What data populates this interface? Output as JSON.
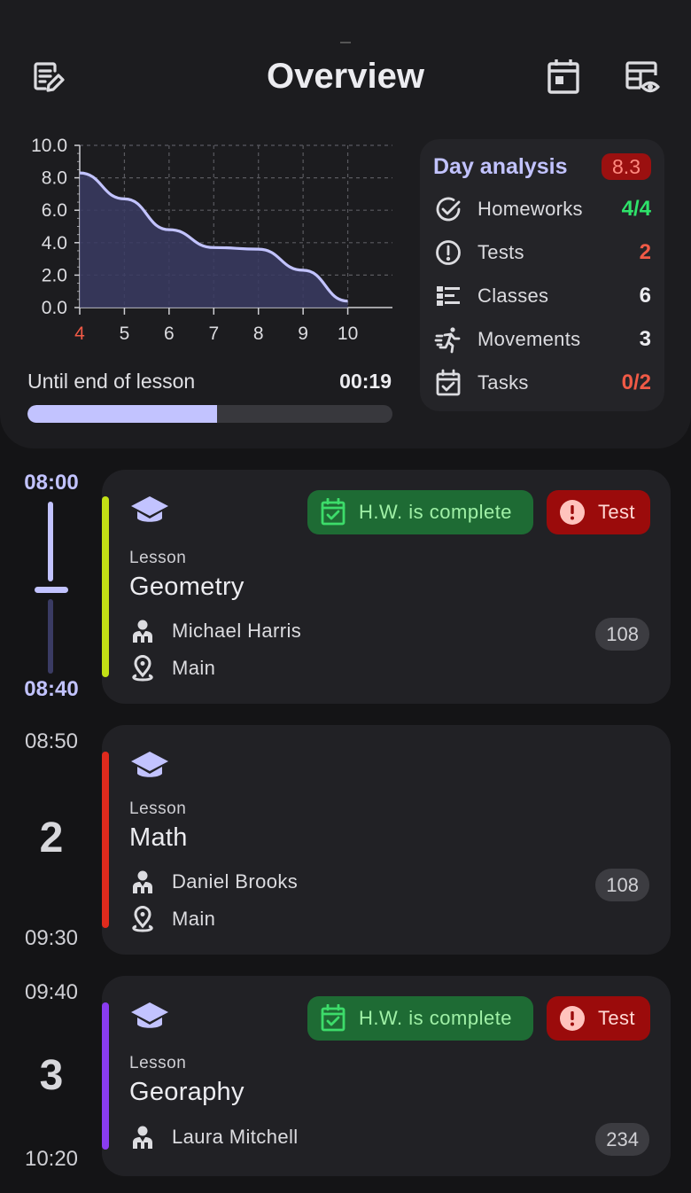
{
  "header": {
    "title": "Overview",
    "left_icon": "edit-notes-icon",
    "right_icons": [
      "calendar-icon",
      "timetable-view-icon"
    ]
  },
  "chart_data": {
    "type": "area",
    "x": [
      4,
      5,
      6,
      7,
      8,
      9,
      10
    ],
    "values": [
      8.3,
      6.7,
      4.8,
      3.7,
      3.6,
      2.3,
      0.4
    ],
    "xlim": [
      4,
      11
    ],
    "ylim": [
      0,
      10
    ],
    "yticks": [
      "0.0",
      "2.0",
      "4.0",
      "6.0",
      "8.0",
      "10.0"
    ],
    "xticks": [
      "4",
      "5",
      "6",
      "7",
      "8",
      "9",
      "10"
    ],
    "highlight_x": "4",
    "grid": true,
    "line_color": "#c2c3ff",
    "fill_color": "#3a3b63",
    "highlight_color": "#f05a46"
  },
  "progress": {
    "label": "Until end of lesson",
    "time": "00:19",
    "fraction": 0.52
  },
  "analysis": {
    "title": "Day analysis",
    "score": "8.3",
    "rows": [
      {
        "label": "Homeworks",
        "value": "4/4",
        "icon": "check-circle-icon",
        "color": "#2ee36a"
      },
      {
        "label": "Tests",
        "value": "2",
        "icon": "alert-circle-icon",
        "color": "#f05a46"
      },
      {
        "label": "Classes",
        "value": "6",
        "icon": "list-icon",
        "color": "#ececf0"
      },
      {
        "label": "Movements",
        "value": "3",
        "icon": "running-icon",
        "color": "#ececf0"
      },
      {
        "label": "Tasks",
        "value": "0/2",
        "icon": "calendar-check-icon",
        "color": "#f05a46"
      }
    ]
  },
  "lessons": [
    {
      "start": "08:00",
      "end": "08:40",
      "number": "",
      "label": "Lesson",
      "title": "Geometry",
      "teacher": "Michael Harris",
      "location": "Main",
      "room": "108",
      "hw_badge": "H.W. is complete",
      "test_badge": "Test",
      "accent": "#c2e015"
    },
    {
      "start": "08:50",
      "end": "09:30",
      "number": "2",
      "label": "Lesson",
      "title": "Math",
      "teacher": "Daniel Brooks",
      "location": "Main",
      "room": "108",
      "accent": "#e02a1d"
    },
    {
      "start": "09:40",
      "end": "10:20",
      "number": "3",
      "label": "Lesson",
      "title": "Georaphy",
      "teacher": "Laura Mitchell",
      "room": "234",
      "hw_badge": "H.W. is complete",
      "test_badge": "Test",
      "accent": "#8a3cf0"
    }
  ]
}
